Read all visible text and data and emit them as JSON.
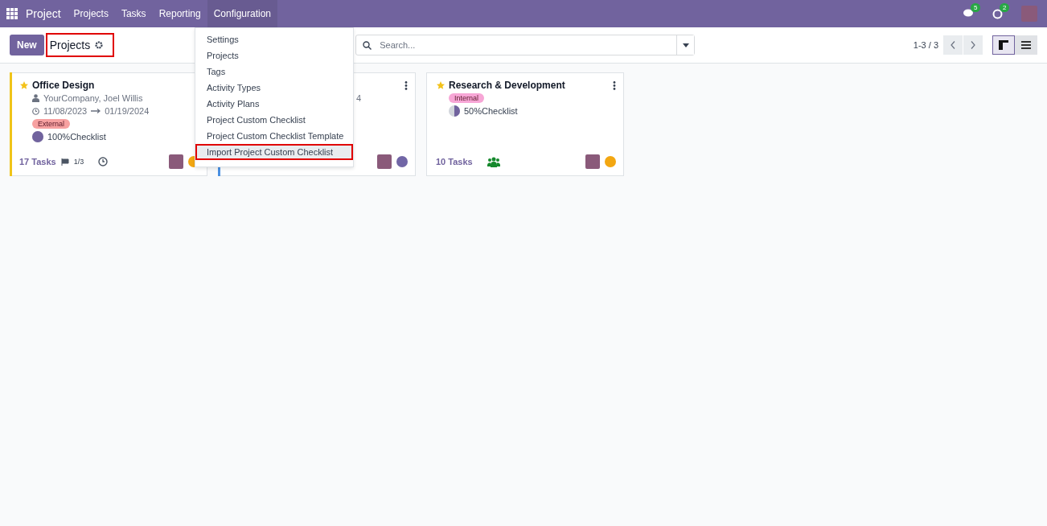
{
  "navbar": {
    "app": "Project",
    "menus": [
      {
        "label": "Projects",
        "selected": false
      },
      {
        "label": "Tasks",
        "selected": false
      },
      {
        "label": "Reporting",
        "selected": false
      },
      {
        "label": "Configuration",
        "selected": true
      }
    ],
    "messages_badge": "5",
    "activities_badge": "2"
  },
  "control_panel": {
    "new_button": "New",
    "breadcrumb": "Projects",
    "breadcrumb_highlighted": true,
    "search": {
      "placeholder": "Search..."
    },
    "pager": "1-3 / 3",
    "views": [
      {
        "kind": "kanban",
        "selected": true
      },
      {
        "kind": "list",
        "selected": false
      }
    ]
  },
  "config_menu": [
    {
      "label": "Settings",
      "highlighted": false
    },
    {
      "label": "Projects",
      "highlighted": false
    },
    {
      "label": "Tags",
      "highlighted": false
    },
    {
      "label": "Activity Types",
      "highlighted": false
    },
    {
      "label": "Activity Plans",
      "highlighted": false
    },
    {
      "label": "Project Custom Checklist",
      "highlighted": false
    },
    {
      "label": "Project Custom Checklist Template",
      "highlighted": false
    },
    {
      "label": "Import Project Custom Checklist",
      "highlighted": true
    }
  ],
  "cards": [
    {
      "name": "Office Design",
      "favorite": true,
      "color": "#f0c419",
      "customer": "YourCompany, Joel Willis",
      "start": "11/08/2023",
      "end": "01/19/2024",
      "tag": {
        "label": "External",
        "color": "#f7a1a1"
      },
      "checklist": {
        "level": 1,
        "text": "100%Checklist"
      },
      "tasks": "17 Tasks",
      "milestones": "1/3",
      "status": {
        "color": "#f3a712"
      }
    },
    {
      "color": "#4a90e2",
      "date_tail": "4",
      "status": {
        "color": "#7166a6"
      }
    },
    {
      "name": "Research & Development",
      "favorite": true,
      "tag": {
        "label": "Internal",
        "color": "#f7a6d6"
      },
      "checklist": {
        "level": 0.5,
        "text": "50%Checklist"
      },
      "tasks": "10 Tasks",
      "status": {
        "color": "#f3a712"
      }
    }
  ]
}
